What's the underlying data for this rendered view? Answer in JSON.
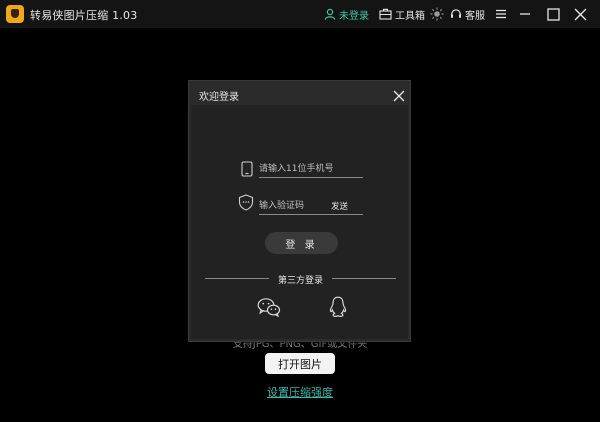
{
  "titlebar": {
    "app_title": "转易侠图片压缩 1.03",
    "login_label": "未登录",
    "toolbox_label": "工具箱",
    "service_label": "客服"
  },
  "background": {
    "hint_text": "支持JPG、PNG、GIF或文件夹",
    "open_button": "打开图片",
    "settings_link": "设置压缩强度"
  },
  "dialog": {
    "title": "欢迎登录",
    "phone_placeholder": "请输入11位手机号",
    "code_placeholder": "输入验证码",
    "send_label": "发送",
    "login_button": "登 录",
    "third_party_label": "第三方登录"
  },
  "colors": {
    "accent": "#3ec7a0",
    "link": "#35b8ad",
    "logo": "#f0a818"
  }
}
